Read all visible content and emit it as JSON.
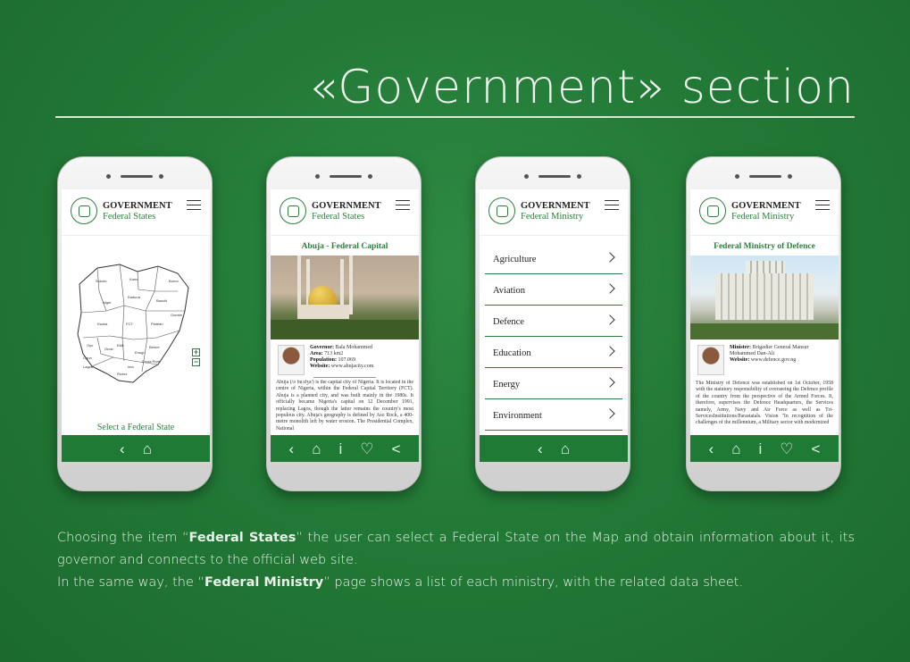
{
  "page_title": "«Government» section",
  "app": {
    "title": "GOVERNMENT",
    "bottom_nav_icons": [
      "back-chevron",
      "home",
      "info",
      "heart",
      "share"
    ]
  },
  "screens": [
    {
      "subtitle": "Federal States",
      "map": {
        "states": [
          "Sokoto",
          "Kano",
          "Borno",
          "Niger",
          "Kaduna",
          "Bauchi",
          "Gombe",
          "Kwara",
          "FCT",
          "Plateau",
          "Oyo",
          "Ogun",
          "Ondo",
          "Benue",
          "Ekiti",
          "Enugu",
          "Lagos",
          "Imo",
          "Cross River",
          "Rivers"
        ],
        "zoom_in": "+",
        "zoom_out": "−"
      },
      "caption": "Select a Federal State"
    },
    {
      "subtitle": "Federal States",
      "section_title": "Abuja - Federal Capital",
      "governor_label": "Governor:",
      "governor": "Bala Mohammed",
      "area_label": "Area:",
      "area": "713 km2",
      "population_label": "Population:",
      "population": "107.069",
      "website_label": "Website:",
      "website": "www.abujacity.com",
      "body": "Abuja (/əˈbuːdʒə/) is the capital city of Nigeria. It is located in the centre of Nigeria, within the Federal Capital Territory (FCT). Abuja is a planned city, and was built mainly in the 1980s. It officially became Nigeria's capital on 12 December 1991, replacing Lagos, though the latter remains the country's most populous city. Abuja's geography is defined by Aso Rock, a 400-metre monolith left by water erosion. The Presidential Complex, National"
    },
    {
      "subtitle": "Federal Ministry",
      "ministries": [
        "Agriculture",
        "Aviation",
        "Defence",
        "Education",
        "Energy",
        "Environment"
      ]
    },
    {
      "subtitle": "Federal Ministry",
      "section_title": "Federal Ministry of Defence",
      "minister_label": "Minister:",
      "minister": "Brigadier General Mansur Mohammed Dan-Ali",
      "website_label": "Website:",
      "website": "www.defence.gov.ng",
      "body": "The Ministry of Defence was established on 1st October, 1958 with the statutory responsibility of overseeing the Defence profile of the country from the perspective of the Armed Forces. It, therefore, supervises the Defence Headquarters, the Services namely, Army, Navy and Air Force as well as Tri-ServicesInstitutions/Parastatals. Vision \"In recognition of the challenges of the millennium, a Military sector with modernized"
    }
  ],
  "description": {
    "line1_pre": "Choosing the item “",
    "line1_bold": "Federal States",
    "line1_post": "” the user can select a Federal State on the Map and obtain information about it, its governor and connects to the official web site.",
    "line2_pre": "In the same way, the “",
    "line2_bold": "Federal Ministry",
    "line2_post": "” page shows a list of each ministry, with the related data sheet."
  },
  "colors": {
    "brand_green": "#2e7d3e",
    "nav_green": "#1f7a36",
    "background": "#237a37"
  }
}
